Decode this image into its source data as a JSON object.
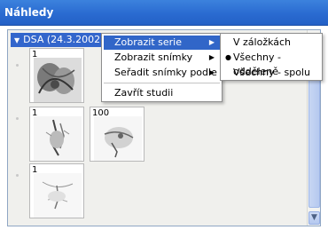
{
  "window": {
    "title": "Náhledy"
  },
  "series": {
    "header": "DSA (24.3.2002)"
  },
  "thumbnails": [
    {
      "label": "1"
    },
    {
      "label": "1"
    },
    {
      "label": "100"
    },
    {
      "label": "1"
    }
  ],
  "context_menu": {
    "items": [
      {
        "label": "Zobrazit serie",
        "has_submenu": true
      },
      {
        "label": "Zobrazit snímky",
        "has_submenu": true
      },
      {
        "label": "Seřadit snímky podle",
        "has_submenu": true
      },
      {
        "label": "Zavřít studii",
        "has_submenu": false
      }
    ]
  },
  "submenu": {
    "items": [
      {
        "label": "V záložkách",
        "checked": false
      },
      {
        "label": "Všechny - odděleně",
        "checked": true
      },
      {
        "label": "Všechny - spolu",
        "checked": false
      }
    ]
  },
  "icons": {
    "submenu_arrow": "triangle-right-icon",
    "bullet": "radio-bullet-icon",
    "expand": "triangle-down-icon",
    "scroll_down": "chevron-down-icon"
  }
}
